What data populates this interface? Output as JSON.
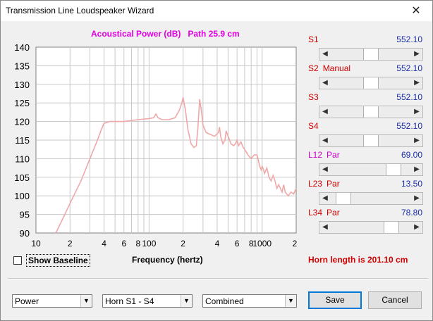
{
  "window": {
    "title": "Transmission Line Loudspeaker Wizard",
    "close_glyph": "✕"
  },
  "chart": {
    "title": "Acoustical Power (dB)   Path 25.9 cm",
    "xlabel": "Frequency (hertz)",
    "curve_color": "#f0a8a8",
    "grid_color": "#c8c8c8"
  },
  "chart_data": {
    "type": "line",
    "title": "Acoustical Power (dB)   Path 25.9 cm",
    "xlabel": "Frequency (hertz)",
    "ylabel": "",
    "x_scale": "log",
    "xlim": [
      10,
      2000
    ],
    "ylim": [
      90,
      140
    ],
    "grid": true,
    "y_ticks": [
      90,
      95,
      100,
      105,
      110,
      115,
      120,
      125,
      130,
      135,
      140
    ],
    "x_tick_labels": [
      {
        "v": 10,
        "t": "10"
      },
      {
        "v": 20,
        "t": "2"
      },
      {
        "v": 40,
        "t": "4"
      },
      {
        "v": 60,
        "t": "6"
      },
      {
        "v": 80,
        "t": "8"
      },
      {
        "v": 100,
        "t": "100"
      },
      {
        "v": 200,
        "t": "2"
      },
      {
        "v": 400,
        "t": "4"
      },
      {
        "v": 600,
        "t": "6"
      },
      {
        "v": 800,
        "t": "8"
      },
      {
        "v": 1000,
        "t": "1000"
      },
      {
        "v": 2000,
        "t": "2"
      }
    ],
    "series": [
      {
        "x": [
          15,
          18,
          20,
          25,
          30,
          35,
          38,
          40,
          45,
          60,
          80,
          100,
          110,
          115,
          120,
          130,
          150,
          170,
          185,
          195,
          200,
          210,
          220,
          235,
          250,
          262,
          270,
          280,
          290,
          300,
          320,
          350,
          380,
          410,
          420,
          430,
          450,
          470,
          480,
          500,
          530,
          560,
          580,
          600,
          620,
          650,
          680,
          700,
          750,
          800,
          850,
          900,
          920,
          950,
          980,
          1000,
          1030,
          1050,
          1100,
          1150,
          1200,
          1250,
          1300,
          1350,
          1400,
          1500,
          1550,
          1600,
          1700,
          1800,
          1900,
          2000
        ],
        "y": [
          90,
          95,
          98,
          104,
          110,
          115,
          118,
          119.5,
          120,
          120,
          120.5,
          120.8,
          121,
          122,
          121,
          120.5,
          120.5,
          121,
          123,
          125,
          126.5,
          123,
          118,
          114,
          113,
          113.5,
          118,
          126,
          123,
          119,
          117,
          116.5,
          116,
          117,
          118.5,
          116,
          114,
          115,
          117.5,
          116,
          114,
          113.5,
          114,
          115,
          113.5,
          114.5,
          113,
          112.5,
          111,
          110,
          111,
          111,
          110,
          108,
          107,
          108,
          107,
          106,
          107.5,
          105,
          104,
          105.5,
          104,
          102,
          103,
          101,
          103,
          101,
          100,
          101,
          100.5,
          102
        ]
      }
    ]
  },
  "sliders": [
    {
      "label": "S1",
      "mode": "",
      "value": "552.10",
      "position": 0.5,
      "label_color": "#d00000"
    },
    {
      "label": "S2",
      "mode": "Manual",
      "value": "552.10",
      "position": 0.5,
      "label_color": "#d00000"
    },
    {
      "label": "S3",
      "mode": "",
      "value": "552.10",
      "position": 0.5,
      "label_color": "#d00000"
    },
    {
      "label": "S4",
      "mode": "",
      "value": "552.10",
      "position": 0.5,
      "label_color": "#d00000"
    },
    {
      "label": "L12",
      "mode": "Par",
      "value": "69.00",
      "position": 0.85,
      "label_color": "#cc00cc"
    },
    {
      "label": "L23",
      "mode": "Par",
      "value": "13.50",
      "position": 0.08,
      "label_color": "#d00000"
    },
    {
      "label": "L34",
      "mode": "Par",
      "value": "78.80",
      "position": 0.82,
      "label_color": "#d00000"
    }
  ],
  "show_baseline": {
    "label": "Show Baseline",
    "checked": false
  },
  "horn_length": "Horn length is 201.10 cm",
  "combos": [
    {
      "name": "plot-type-select",
      "value": "Power"
    },
    {
      "name": "horn-section-select",
      "value": "Horn S1 - S4"
    },
    {
      "name": "output-mode-select",
      "value": "Combined"
    }
  ],
  "buttons": {
    "save": "Save",
    "cancel": "Cancel"
  },
  "colors": {
    "value_blue": "#1a2ea8",
    "title_magenta": "#e000e0",
    "horn_red": "#d00000"
  }
}
